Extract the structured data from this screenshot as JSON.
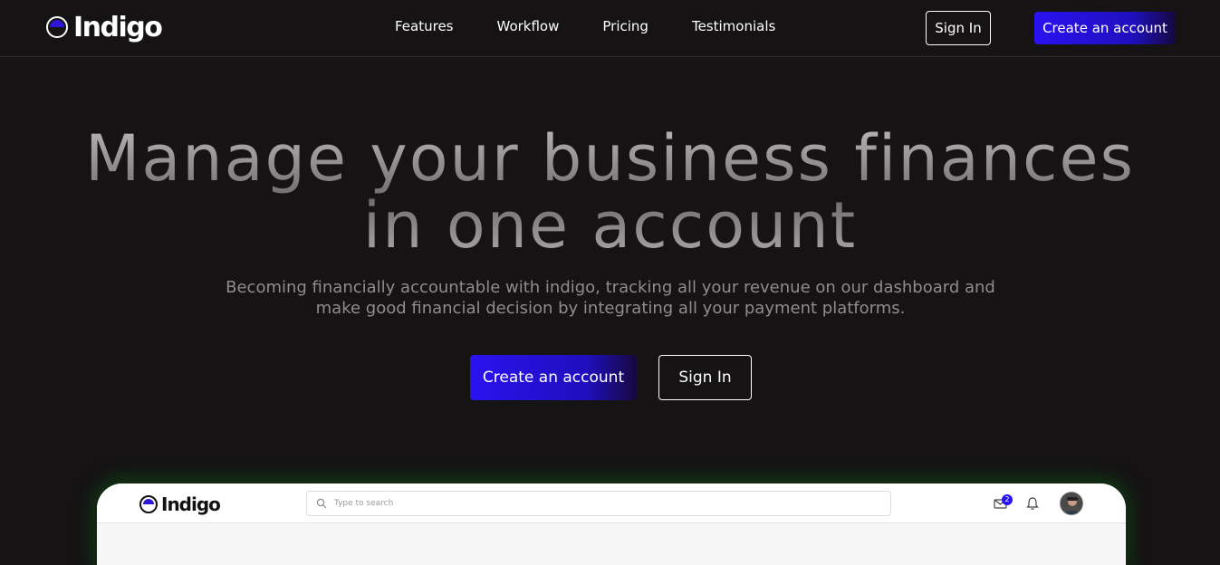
{
  "brand": {
    "name": "Indigo",
    "accent_color": "#2a12f0",
    "background_color": "#151314"
  },
  "nav": {
    "links": [
      "Features",
      "Workflow",
      "Pricing",
      "Testimonials"
    ],
    "sign_in": "Sign In",
    "create_account": "Create an account"
  },
  "hero": {
    "title_line1": "Manage your business finances",
    "title_line2": "in one account",
    "subtitle": "Becoming financially accountable with indigo, tracking all your revenue on our dashboard and make good financial decision by integrating all your payment platforms.",
    "create_account": "Create an account",
    "sign_in": "Sign In"
  },
  "preview": {
    "logo": "Indigo",
    "search_placeholder": "Type to search",
    "mail_badge": "2",
    "icons": [
      "search-icon",
      "mail-icon",
      "bell-icon",
      "avatar"
    ]
  }
}
